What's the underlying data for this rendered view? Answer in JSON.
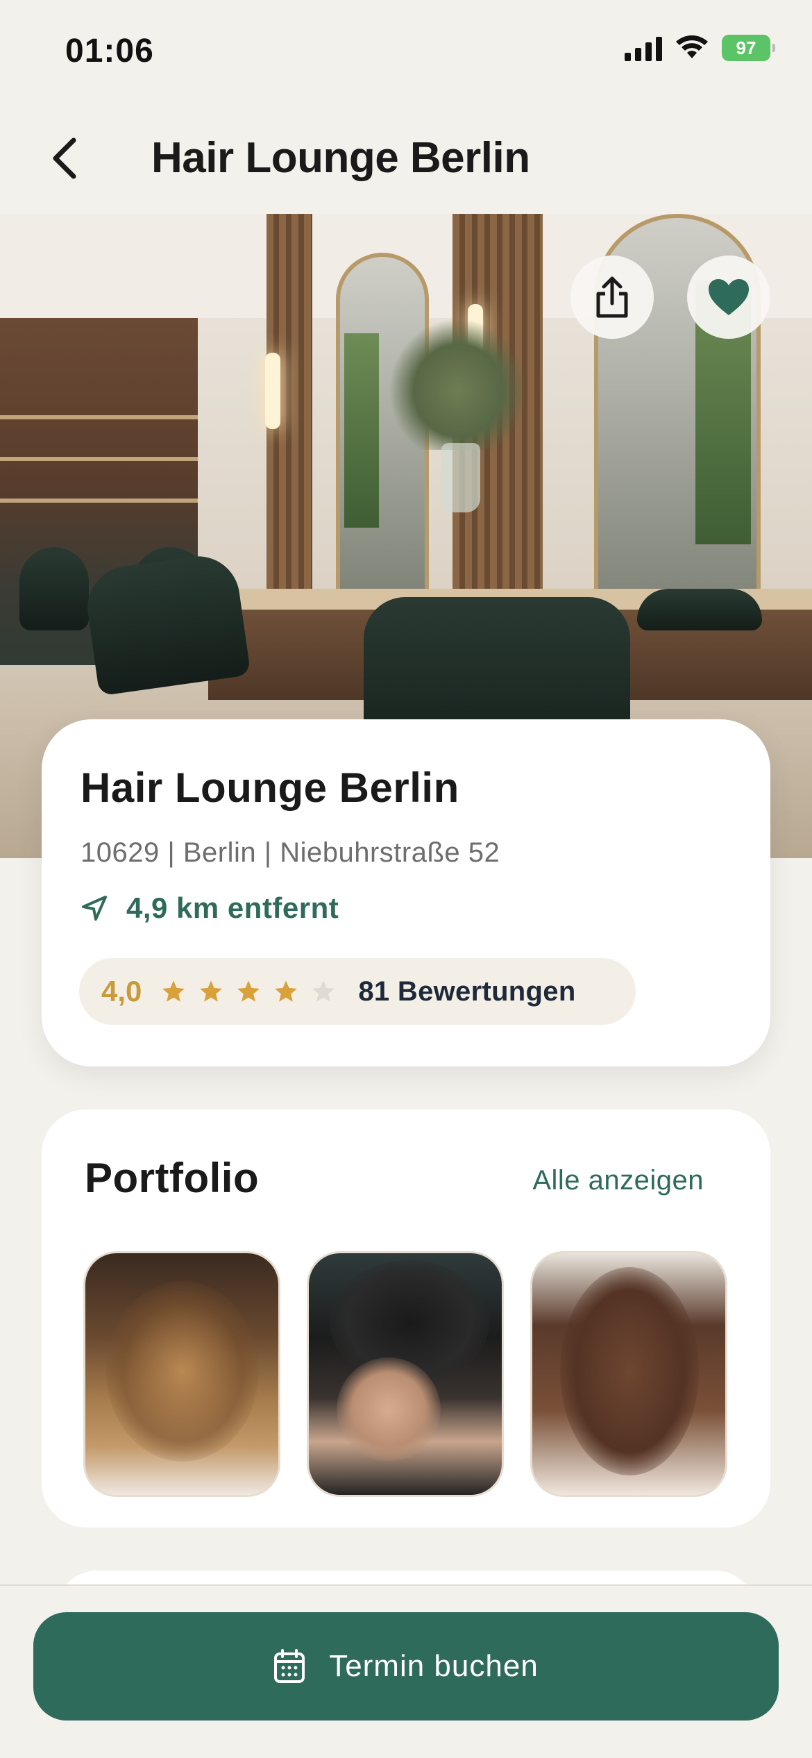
{
  "status_bar": {
    "time": "01:06",
    "battery": "97",
    "icons": [
      "signal-icon",
      "wifi-icon",
      "battery-icon"
    ]
  },
  "header": {
    "title": "Hair Lounge Berlin",
    "back_icon": "chevron-left-icon"
  },
  "hero": {
    "actions": [
      "share-icon",
      "heart-icon"
    ],
    "favorite_color": "#2f6b5b"
  },
  "salon": {
    "name": "Hair Lounge Berlin",
    "address": "10629 | Berlin | Niebuhrstraße 52",
    "distance": "4,9 km entfernt",
    "rating": "4,0",
    "rating_stars": 4,
    "rating_max": 5,
    "reviews": "81 Bewertungen"
  },
  "portfolio": {
    "title": "Portfolio",
    "show_all": "Alle anzeigen",
    "items": [
      "balayage-waves",
      "fade-haircut",
      "layered-cut"
    ]
  },
  "booking": {
    "label": "Termin buchen",
    "icon": "calendar-icon"
  },
  "colors": {
    "accent": "#2f6b5b",
    "rating": "#c99a3a",
    "background": "#f3f1ec"
  }
}
